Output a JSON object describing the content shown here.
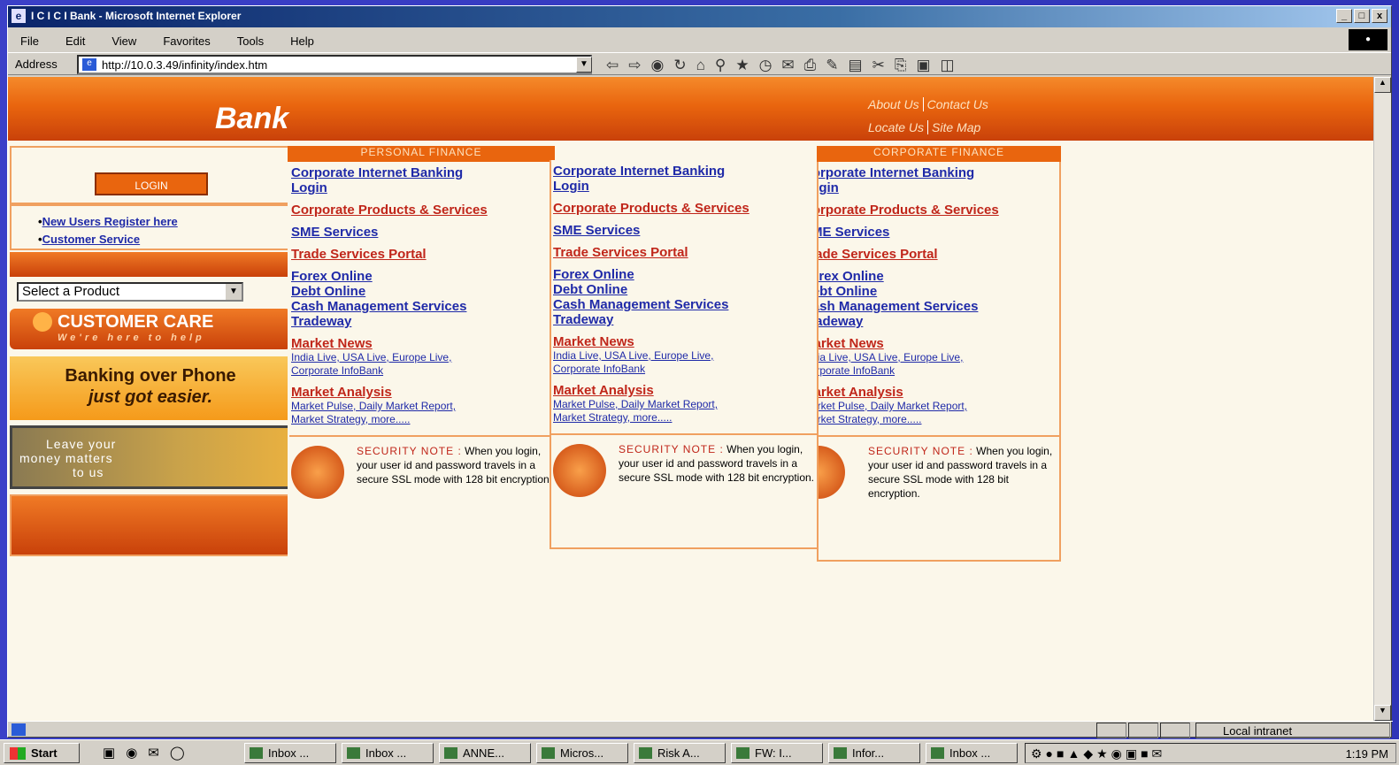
{
  "window": {
    "title": "I C I C I Bank - Microsoft Internet Explorer",
    "buttons": [
      "_",
      "□",
      "x"
    ]
  },
  "menu": [
    "File",
    "Edit",
    "View",
    "Favorites",
    "Tools",
    "Help"
  ],
  "address": {
    "label": "Address",
    "url": "http://10.0.3.49/infinity/index.htm"
  },
  "toolbar_icons": [
    "back-icon",
    "forward-icon",
    "stop-icon",
    "refresh-icon",
    "home-icon",
    "search-icon",
    "favorites-icon",
    "history-icon",
    "mail-icon",
    "print-icon",
    "edit-icon",
    "discuss-icon",
    "cut-icon",
    "copy-icon",
    "paste-icon",
    "preview-icon"
  ],
  "banner": {
    "brand": "Bank",
    "links": [
      "About Us",
      "Contact Us",
      "Locate Us",
      "Site Map"
    ]
  },
  "left": {
    "login": "LOGIN",
    "new_users": "New Users Register here",
    "customer_service": "Customer Service",
    "product_select": "Select a Product",
    "customer_care": "CUSTOMER CARE",
    "customer_care_tag": "We're here to help",
    "phone_line1": "Banking over Phone",
    "phone_line2": "just got easier.",
    "money_line1": "Leave your",
    "money_line2": "money matters",
    "money_line3": "to us"
  },
  "panels": {
    "personal_header": "PERSONAL FINANCE",
    "corporate_header": "CORPORATE FINANCE",
    "links": {
      "cib": "Corporate Internet Banking",
      "login": "Login",
      "cps": "Corporate Products & Services",
      "sme": "SME Services",
      "trade": "Trade Services Portal",
      "forex": "Forex Online",
      "debt": "Debt Online",
      "cash": "Cash Management Services",
      "tradeway": "Tradeway",
      "market_news": "Market News",
      "news_sub1": "India Live, USA Live, Europe Live,",
      "news_sub2": "Corporate InfoBank",
      "market_analysis": "Market Analysis",
      "analysis_sub1": "Market Pulse, Daily Market Report,",
      "analysis_sub2": "Market Strategy, more....."
    },
    "security_title": "SECURITY NOTE :",
    "security_text": "When you login, your user id and password travels in a secure SSL mode with 128 bit encryption."
  },
  "status": {
    "zone": "Local intranet"
  },
  "taskbar": {
    "start": "Start",
    "tasks": [
      "Inbox ...",
      "Inbox ...",
      "ANNE...",
      "Micros...",
      "Risk A...",
      "FW: I...",
      "Infor...",
      "Inbox ..."
    ],
    "clock": "1:19 PM"
  }
}
